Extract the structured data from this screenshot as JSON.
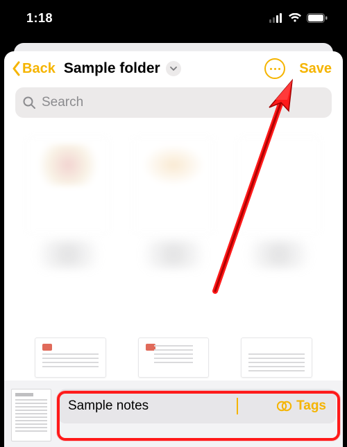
{
  "status": {
    "time": "1:18"
  },
  "nav": {
    "back_label": "Back",
    "folder_title": "Sample folder",
    "save_label": "Save"
  },
  "search": {
    "placeholder": "Search"
  },
  "note": {
    "name_value": "Sample notes",
    "tags_label": "Tags"
  },
  "accent_color": "#f5b400"
}
